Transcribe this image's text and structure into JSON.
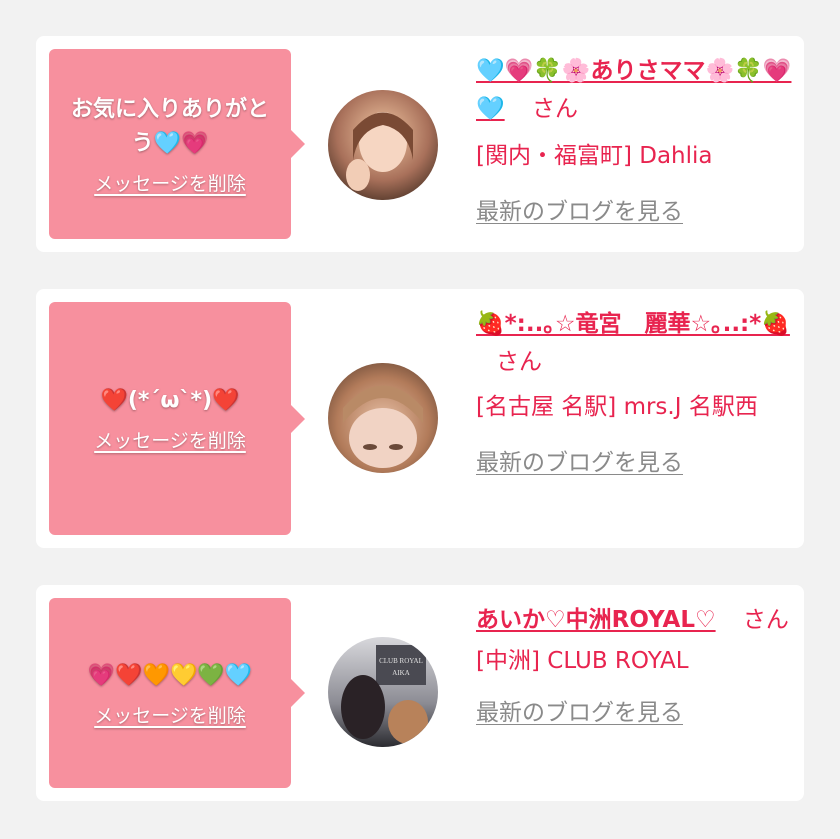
{
  "favorites": [
    {
      "message": "お気に入りありがとう🩵💗",
      "delete_label": "メッセージを削除",
      "name": "🩵💗🍀🌸ありさママ🌸🍀💗🩵",
      "honorific": "さん",
      "shop": "[関内・福富町] Dahlia",
      "blog_label": "最新のブログを見る",
      "avatar_colors": [
        "#f3c9a4",
        "#a8705a",
        "#3e2a1e"
      ]
    },
    {
      "message": "❤️(*´ω`*)❤️",
      "delete_label": "メッセージを削除",
      "name": "🍓*:..｡☆竜宮　麗華☆｡..:*🍓",
      "honorific": "さん",
      "shop": "[名古屋 名駅] mrs.J 名駅西",
      "blog_label": "最新のブログを見る",
      "avatar_colors": [
        "#e9c2a8",
        "#b27b5a",
        "#5a3d2e"
      ]
    },
    {
      "message": "💗❤️🧡💛💚🩵",
      "delete_label": "メッセージを削除",
      "name": "あいか♡中洲ROYAL♡",
      "honorific": "さん",
      "shop": "[中洲] CLUB ROYAL",
      "blog_label": "最新のブログを見る",
      "avatar_colors": [
        "#d8d8dc",
        "#8c8c94",
        "#2b2b30"
      ],
      "avatar_sign": "CLUB ROYAL AIKA"
    }
  ]
}
